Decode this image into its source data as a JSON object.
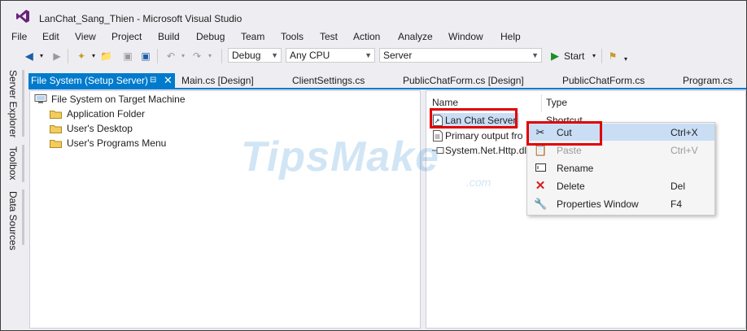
{
  "window": {
    "title": "LanChat_Sang_Thien - Microsoft Visual Studio"
  },
  "menu": [
    "File",
    "Edit",
    "View",
    "Project",
    "Build",
    "Debug",
    "Team",
    "Tools",
    "Test",
    "Action",
    "Analyze",
    "Window",
    "Help"
  ],
  "toolbar": {
    "config": "Debug",
    "platform": "Any CPU",
    "project": "Server",
    "start_label": "Start"
  },
  "left_rail": [
    "Server Explorer",
    "Toolbox",
    "Data Sources"
  ],
  "tabs": {
    "active": "File System (Setup Server)",
    "others": [
      "Main.cs [Design]",
      "ClientSettings.cs",
      "PublicChatForm.cs [Design]",
      "PublicChatForm.cs",
      "Program.cs"
    ]
  },
  "tree": {
    "root": "File System on Target Machine",
    "folders": [
      "Application Folder",
      "User's Desktop",
      "User's Programs Menu"
    ]
  },
  "list": {
    "col_name": "Name",
    "col_type": "Type",
    "items": [
      {
        "name": "Lan Chat Server",
        "type": "Shortcut"
      },
      {
        "name": "Primary output fro",
        "type": ""
      },
      {
        "name": "System.Net.Http.dll",
        "type": ""
      }
    ]
  },
  "context_menu": [
    {
      "label": "Cut",
      "shortcut": "Ctrl+X",
      "icon": "scissors-icon",
      "enabled": true
    },
    {
      "label": "Paste",
      "shortcut": "Ctrl+V",
      "icon": "paste-icon",
      "enabled": false
    },
    {
      "label": "Rename",
      "shortcut": "",
      "icon": "rename-icon",
      "enabled": true
    },
    {
      "label": "Delete",
      "shortcut": "Del",
      "icon": "delete-icon",
      "enabled": true
    },
    {
      "label": "Properties Window",
      "shortcut": "F4",
      "icon": "wrench-icon",
      "enabled": true
    }
  ],
  "colors": {
    "accent": "#007acc",
    "highlight": "#e00000",
    "menu_hover": "#c9def5"
  }
}
